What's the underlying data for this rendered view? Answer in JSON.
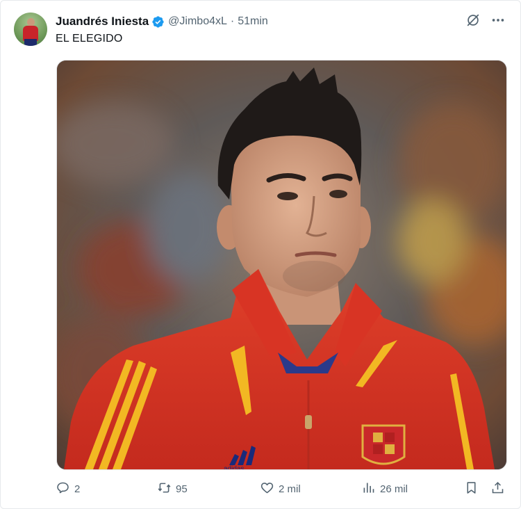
{
  "author": {
    "display_name": "Juandrés Iniesta",
    "handle": "@Jimbo4xL",
    "separator": "·",
    "time": "51min",
    "verified_icon": "verified-badge-icon",
    "verified_color": "#1d9bf0"
  },
  "post": {
    "text": "EL ELEGIDO",
    "media_icon": "photo",
    "media_brand_text": "adidas"
  },
  "top_icons": [
    "grok-icon",
    "more-icon"
  ],
  "actions": {
    "replies": "2",
    "reposts": "95",
    "likes": "2 mil",
    "views": "26 mil"
  },
  "colors": {
    "text_primary": "#0f1419",
    "text_secondary": "#536471",
    "accent": "#1d9bf0"
  }
}
